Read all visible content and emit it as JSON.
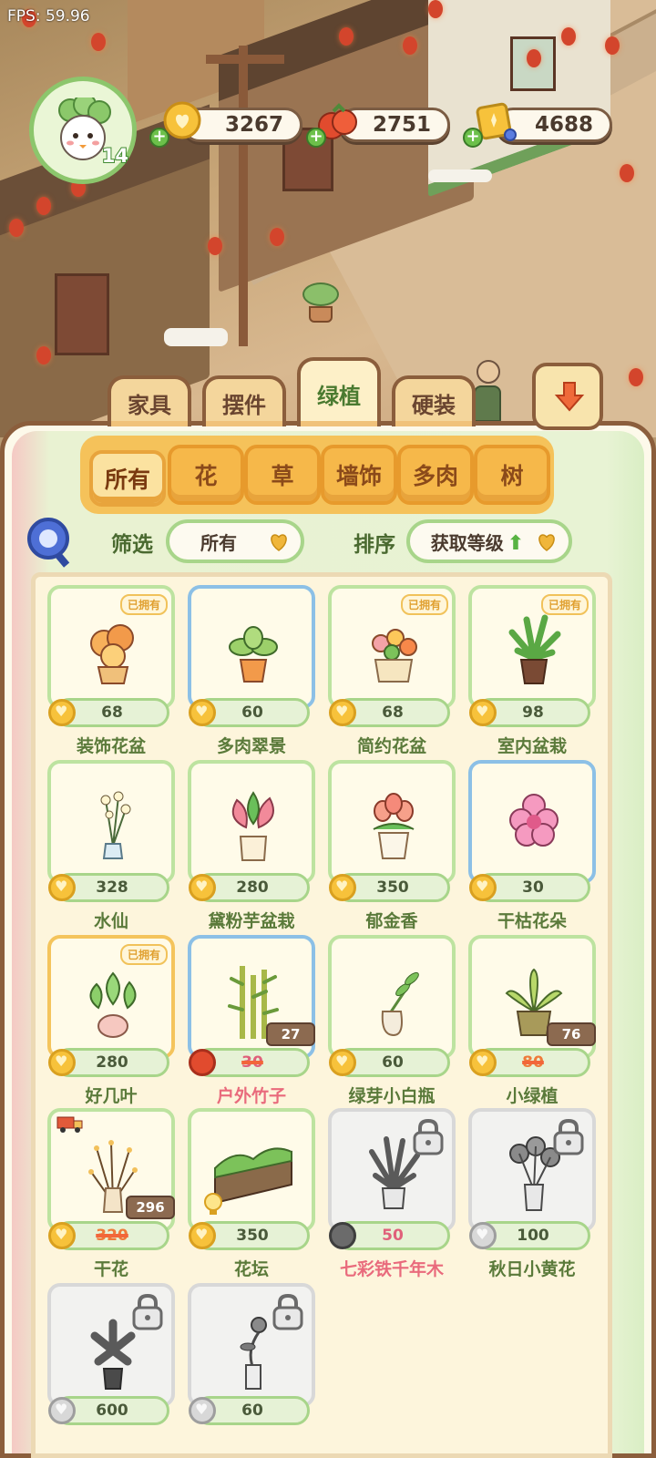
{
  "fps": "FPS: 59.96",
  "player": {
    "level": "14"
  },
  "currencies": [
    {
      "icon": "heart-coin-icon",
      "value": "3267"
    },
    {
      "icon": "tomato-icon",
      "value": "2751"
    },
    {
      "icon": "gold-ticket-icon",
      "value": "4688"
    }
  ],
  "category_tabs": [
    {
      "label": "家具"
    },
    {
      "label": "摆件"
    },
    {
      "label": "绿植"
    },
    {
      "label": "硬装"
    }
  ],
  "sub_tabs": [
    {
      "label": "所有"
    },
    {
      "label": "花"
    },
    {
      "label": "草"
    },
    {
      "label": "墙饰"
    },
    {
      "label": "多肉"
    },
    {
      "label": "树"
    }
  ],
  "filter": {
    "label": "筛选",
    "value": "所有"
  },
  "sort": {
    "label": "排序",
    "value": "获取等级",
    "direction_icon": "up-arrow-icon"
  },
  "owned_badge": "已拥有",
  "items": [
    {
      "name": "装饰花盆",
      "price": "68",
      "owned": true,
      "frame": "green",
      "currency": "coin",
      "art": "orange-flower-pot"
    },
    {
      "name": "多肉翠景",
      "price": "60",
      "owned": false,
      "frame": "blue",
      "currency": "coin",
      "art": "succulent-pot"
    },
    {
      "name": "简约花盆",
      "price": "68",
      "owned": true,
      "frame": "green",
      "currency": "coin",
      "art": "basket-flowers"
    },
    {
      "name": "室内盆栽",
      "price": "98",
      "owned": true,
      "frame": "green",
      "currency": "coin",
      "art": "fern-pot"
    },
    {
      "name": "水仙",
      "price": "328",
      "owned": false,
      "frame": "green",
      "currency": "coin",
      "art": "narcissus-vase"
    },
    {
      "name": "黛粉芋盆栽",
      "price": "280",
      "owned": false,
      "frame": "green",
      "currency": "coin",
      "art": "pink-caladium"
    },
    {
      "name": "郁金香",
      "price": "350",
      "owned": false,
      "frame": "green",
      "currency": "coin",
      "art": "tulip-pot"
    },
    {
      "name": "干枯花朵",
      "price": "30",
      "owned": false,
      "frame": "blue",
      "currency": "coin",
      "art": "pink-flower"
    },
    {
      "name": "好几叶",
      "price": "280",
      "owned": true,
      "frame": "gold",
      "currency": "coin",
      "art": "pothos-pot"
    },
    {
      "name": "户外竹子",
      "price": "30",
      "sale_price": "27",
      "owned": false,
      "frame": "blue",
      "currency": "tomato",
      "art": "bamboo",
      "name_color": "pink"
    },
    {
      "name": "绿芽小白瓶",
      "price": "60",
      "owned": false,
      "frame": "green",
      "currency": "coin",
      "art": "sprout-vase"
    },
    {
      "name": "小绿植",
      "price": "80",
      "sale_price": "76",
      "owned": false,
      "frame": "green",
      "currency": "coin",
      "art": "snake-plant"
    },
    {
      "name": "干花",
      "price": "320",
      "sale_price": "296",
      "owned": false,
      "frame": "green",
      "currency": "coin",
      "art": "dried-flowers",
      "extra_icon": "truck-icon"
    },
    {
      "name": "花坛",
      "price": "350",
      "owned": false,
      "frame": "green",
      "currency": "coin",
      "art": "flower-bed",
      "extra_icon": "lightbulb-icon"
    },
    {
      "name": "七彩铁千年木",
      "price": "50",
      "owned": false,
      "frame": "locked",
      "currency": "grey-ball",
      "art": "dracaena",
      "name_color": "pink",
      "locked": true
    },
    {
      "name": "秋日小黄花",
      "price": "100",
      "owned": false,
      "frame": "locked",
      "currency": "silver-coin",
      "art": "autumn-flowers",
      "locked": true
    },
    {
      "name": "",
      "price": "600",
      "owned": false,
      "frame": "locked",
      "currency": "silver-coin",
      "art": "pinwheel-plant",
      "locked": true
    },
    {
      "name": "",
      "price": "60",
      "owned": false,
      "frame": "locked",
      "currency": "silver-coin",
      "art": "rose-vase",
      "locked": true
    }
  ],
  "colors": {
    "panel_border": "#8b5e3c",
    "card_green": "#bde3a0",
    "card_blue": "#8cc0e6",
    "accent_green": "#58b342",
    "sale_orange": "#f2663a"
  }
}
